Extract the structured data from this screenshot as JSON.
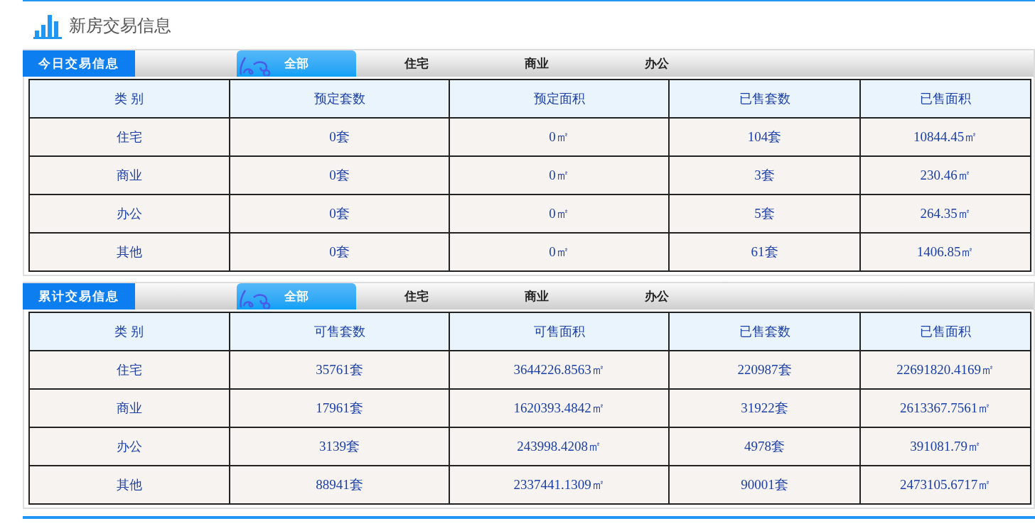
{
  "title": "新房交易信息",
  "sections": [
    {
      "label": "今日交易信息",
      "tabs": [
        {
          "label": "全部",
          "selected": true
        },
        {
          "label": "住宅",
          "selected": false
        },
        {
          "label": "商业",
          "selected": false
        },
        {
          "label": "办公",
          "selected": false
        }
      ],
      "columns": [
        "类 别",
        "预定套数",
        "预定面积",
        "已售套数",
        "已售面积"
      ],
      "rows": [
        [
          "住宅",
          "0套",
          "0㎡",
          "104套",
          "10844.45㎡"
        ],
        [
          "商业",
          "0套",
          "0㎡",
          "3套",
          "230.46㎡"
        ],
        [
          "办公",
          "0套",
          "0㎡",
          "5套",
          "264.35㎡"
        ],
        [
          "其他",
          "0套",
          "0㎡",
          "61套",
          "1406.85㎡"
        ]
      ]
    },
    {
      "label": "累计交易信息",
      "tabs": [
        {
          "label": "全部",
          "selected": true
        },
        {
          "label": "住宅",
          "selected": false
        },
        {
          "label": "商业",
          "selected": false
        },
        {
          "label": "办公",
          "selected": false
        }
      ],
      "columns": [
        "类 别",
        "可售套数",
        "可售面积",
        "已售套数",
        "已售面积"
      ],
      "rows": [
        [
          "住宅",
          "35761套",
          "3644226.8563㎡",
          "220987套",
          "22691820.4169㎡"
        ],
        [
          "商业",
          "17961套",
          "1620393.4842㎡",
          "31922套",
          "2613367.7561㎡"
        ],
        [
          "办公",
          "3139套",
          "243998.4208㎡",
          "4978套",
          "391081.79㎡"
        ],
        [
          "其他",
          "88941套",
          "2337441.1309㎡",
          "90001套",
          "2473105.6717㎡"
        ]
      ]
    }
  ]
}
